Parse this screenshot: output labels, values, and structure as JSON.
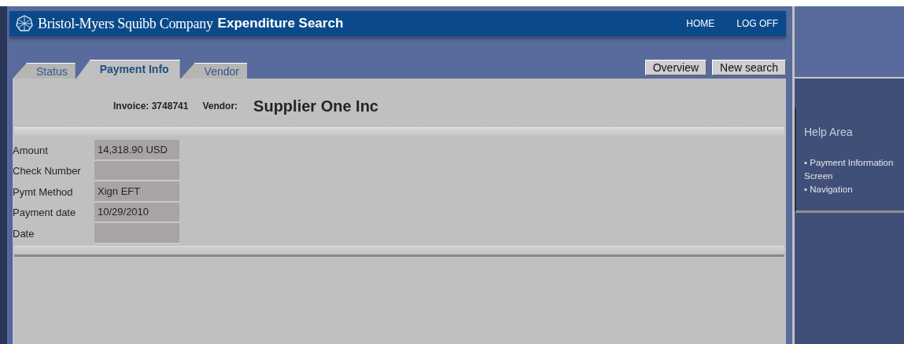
{
  "header": {
    "company": "Bristol-Myers Squibb Company",
    "title": "Expenditure Search",
    "links": [
      "HOME",
      "LOG OFF"
    ]
  },
  "tabs": [
    {
      "label": "Status",
      "selected": false
    },
    {
      "label": "Payment Info",
      "selected": true
    },
    {
      "label": "Vendor",
      "selected": false
    }
  ],
  "buttons": [
    "Overview",
    "New search"
  ],
  "summary": {
    "invoice": "Invoice: 3748741",
    "vendor_label": "Vendor:",
    "vendor_name": "Supplier One Inc"
  },
  "fields": [
    {
      "label": "Amount",
      "value": "14,318.90 USD"
    },
    {
      "label": "Check Number"
    },
    {
      "label": "Pymt Method",
      "value": "Xign EFT"
    },
    {
      "label": "Payment date",
      "value": "10/29/2010"
    },
    {
      "label": "Date"
    }
  ],
  "help": {
    "title": "Help Area",
    "items": [
      "• Payment Information Screen",
      "• Navigation"
    ]
  }
}
